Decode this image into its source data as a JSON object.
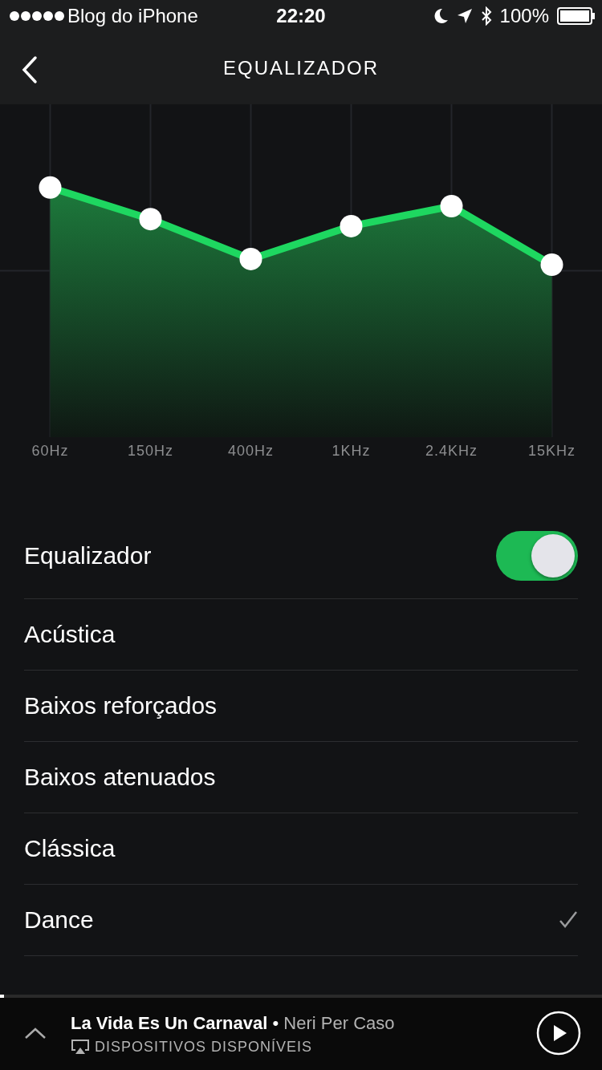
{
  "status_bar": {
    "carrier": "Blog do iPhone",
    "time": "22:20",
    "battery": "100%"
  },
  "header": {
    "title": "EQUALIZADOR"
  },
  "equalizer": {
    "bands": [
      {
        "label": "60Hz"
      },
      {
        "label": "150Hz"
      },
      {
        "label": "400Hz"
      },
      {
        "label": "1KHz"
      },
      {
        "label": "2.4KHz"
      },
      {
        "label": "15KHz"
      }
    ]
  },
  "toggle": {
    "label": "Equalizador",
    "on": true
  },
  "presets": [
    {
      "label": "Acústica",
      "selected": false
    },
    {
      "label": "Baixos reforçados",
      "selected": false
    },
    {
      "label": "Baixos atenuados",
      "selected": false
    },
    {
      "label": "Clássica",
      "selected": false
    },
    {
      "label": "Dance",
      "selected": true
    }
  ],
  "player": {
    "progress": {
      "level": 0.006
    },
    "track": "La Vida Es Un Carnaval",
    "separator": "•",
    "artist": "Neri Per Caso",
    "devices": "DISPOSITIVOS DISPONÍVEIS"
  }
}
